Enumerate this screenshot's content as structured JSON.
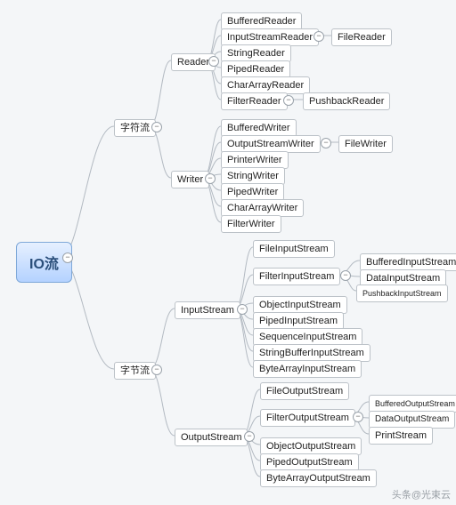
{
  "root": "IO流",
  "level2": {
    "char": "字符流",
    "byte": "字节流"
  },
  "char": {
    "reader": "Reader",
    "writer": "Writer",
    "readerChildren": {
      "buffered": "BufferedReader",
      "isr": "InputStreamReader",
      "string": "StringReader",
      "piped": "PipedReader",
      "chararr": "CharArrayReader",
      "filter": "FilterReader",
      "fileReader": "FileReader",
      "pushback": "PushbackReader"
    },
    "writerChildren": {
      "buffered": "BufferedWriter",
      "osw": "OutputStreamWriter",
      "printer": "PrinterWriter",
      "string": "StringWriter",
      "piped": "PipedWriter",
      "chararr": "CharArrayWriter",
      "filter": "FilterWriter",
      "fileWriter": "FileWriter"
    }
  },
  "byte": {
    "input": "InputStream",
    "output": "OutputStream",
    "inputChildren": {
      "file": "FileInputStream",
      "filter": "FilterInputStream",
      "object": "ObjectInputStream",
      "piped": "PipedInputStream",
      "sequence": "SequenceInputStream",
      "stringBuffer": "StringBufferInputStream",
      "byteArr": "ByteArrayInputStream",
      "buffered": "BufferedInputStream",
      "data": "DataInputStream",
      "pushback": "PushbackInputStream"
    },
    "outputChildren": {
      "file": "FileOutputStream",
      "filter": "FilterOutputStream",
      "object": "ObjectOutputStream",
      "piped": "PipedOutputStream",
      "byteArr": "ByteArrayOutputStream",
      "buffered": "BufferedOutputStream",
      "data": "DataOutputStream",
      "print": "PrintStream"
    }
  },
  "watermark": "头条@光束云",
  "glyph": {
    "minus": "−"
  }
}
